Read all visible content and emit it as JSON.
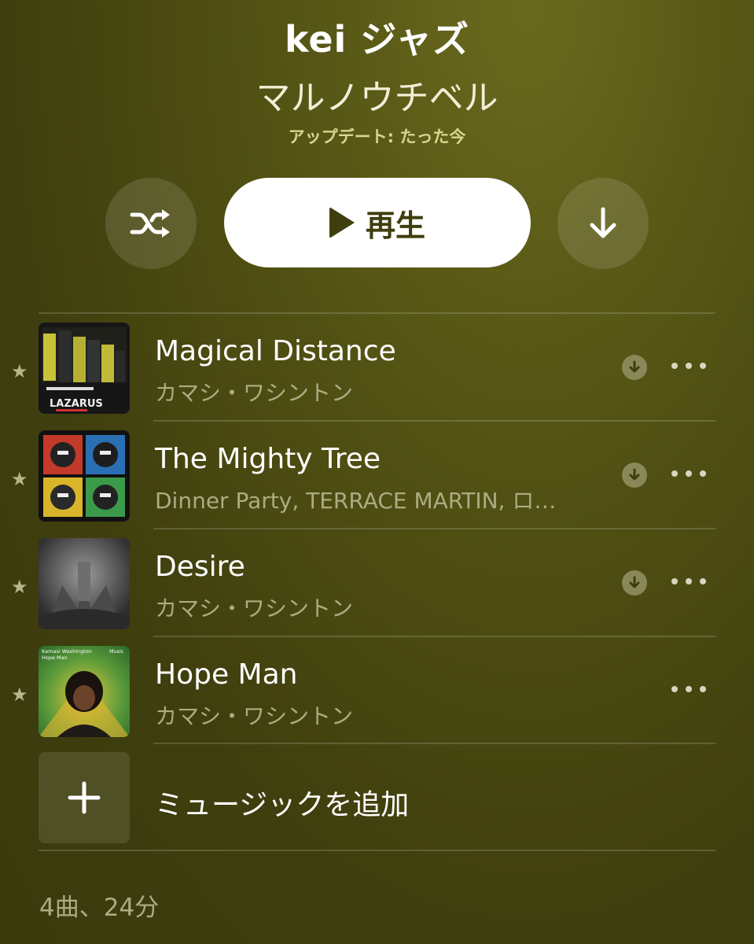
{
  "playlist": {
    "title": "kei ジャズ",
    "owner": "マルノウチベル",
    "updated": "アップデート: たった今"
  },
  "controls": {
    "shuffle_icon": "shuffle-icon",
    "play_label": "再生",
    "download_icon": "arrow-down-icon"
  },
  "tracks": [
    {
      "title": "Magical Distance",
      "artist": "カマシ・ワシントン",
      "favorite": true,
      "downloadable": true,
      "art": "lazarus-artwork"
    },
    {
      "title": "The Mighty Tree",
      "artist": "Dinner Party, TERRACE MARTIN, ロ…",
      "favorite": true,
      "downloadable": true,
      "art": "dinner-party-artwork"
    },
    {
      "title": "Desire",
      "artist": "カマシ・ワシントン",
      "favorite": true,
      "downloadable": true,
      "art": "desire-artwork"
    },
    {
      "title": "Hope Man",
      "artist": "カマシ・ワシントン",
      "favorite": true,
      "downloadable": false,
      "art": "hope-man-artwork",
      "art_text": {
        "artist": "Kamasi Washington",
        "title": "Hope Man",
        "badge": "Music"
      }
    }
  ],
  "add_music_label": "ミュージックを追加",
  "footer": "4曲、24分",
  "colors": {
    "background": "#4a4912",
    "accent_text": "#d9d690",
    "secondary_text": "#aeab83",
    "play_button_bg": "#ffffff"
  }
}
